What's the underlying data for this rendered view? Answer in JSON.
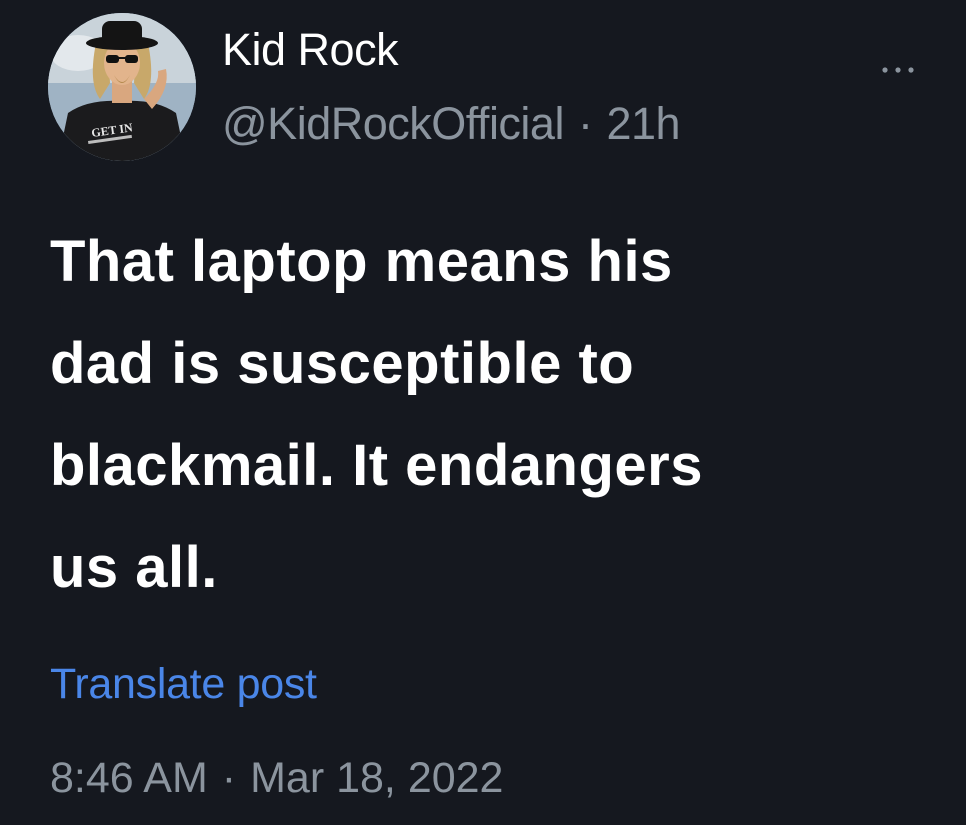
{
  "author": {
    "display_name": "Kid Rock",
    "handle": "@KidRockOfficial",
    "relative_time": "21h",
    "avatar_icon": "profile-photo-avatar",
    "avatar_shirt_text": "GET IN"
  },
  "post": {
    "text_lines": [
      "That laptop means his",
      "dad is susceptible to",
      "blackmail. It endangers",
      "us all."
    ],
    "translate_label": "Translate post",
    "time": "8:46 AM",
    "date": "Mar 18, 2022",
    "separator": "·"
  },
  "more_menu": {
    "icon": "more-horizontal-icon"
  },
  "colors": {
    "background": "#15181f",
    "primary_text": "#ffffff",
    "secondary_text": "#8b949e",
    "link": "#4a86e8"
  }
}
